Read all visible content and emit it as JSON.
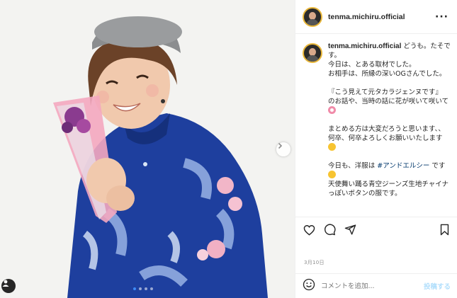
{
  "post": {
    "username": "tenma.michiru.official",
    "more_icon": "more-horizontal-icon",
    "photo_alt": "",
    "carousel": {
      "count": 4,
      "active_index": 0
    }
  },
  "caption": {
    "username": "tenma.michiru.official",
    "lines": {
      "l1": "どうも。たそです。",
      "l2": "今日は、とある取材でした。",
      "l3": "お相手は、所縁の深いOGさんでした。",
      "l4": "『こう見えて元タカラジェンヌです』",
      "l5": "のお話や、当時の話に花が咲いて咲いて",
      "l6": "まとめる方は大変だろうと思います、、",
      "l7": "何卒、何卒よろしくお願いいたします",
      "l8a": "今日も、洋服は",
      "hashtag": "#アンドエルシー",
      "l8b": "です",
      "l9": "天使舞い踊る青空ジーンズ生地チャイナっぽいボタンの服です。"
    }
  },
  "actions": {
    "like_icon": "heart-icon",
    "comment_icon": "comment-icon",
    "share_icon": "share-icon",
    "save_icon": "bookmark-icon"
  },
  "date": "3月10日",
  "comment": {
    "placeholder": "コメントを追加...",
    "post_label": "投稿する",
    "emoji_icon": "emoji-icon"
  },
  "colors": {
    "link": "#00376b",
    "post_button": "#b2dffc",
    "coat": "#1e3f9e",
    "avatar_ring": "#e9b73a"
  }
}
